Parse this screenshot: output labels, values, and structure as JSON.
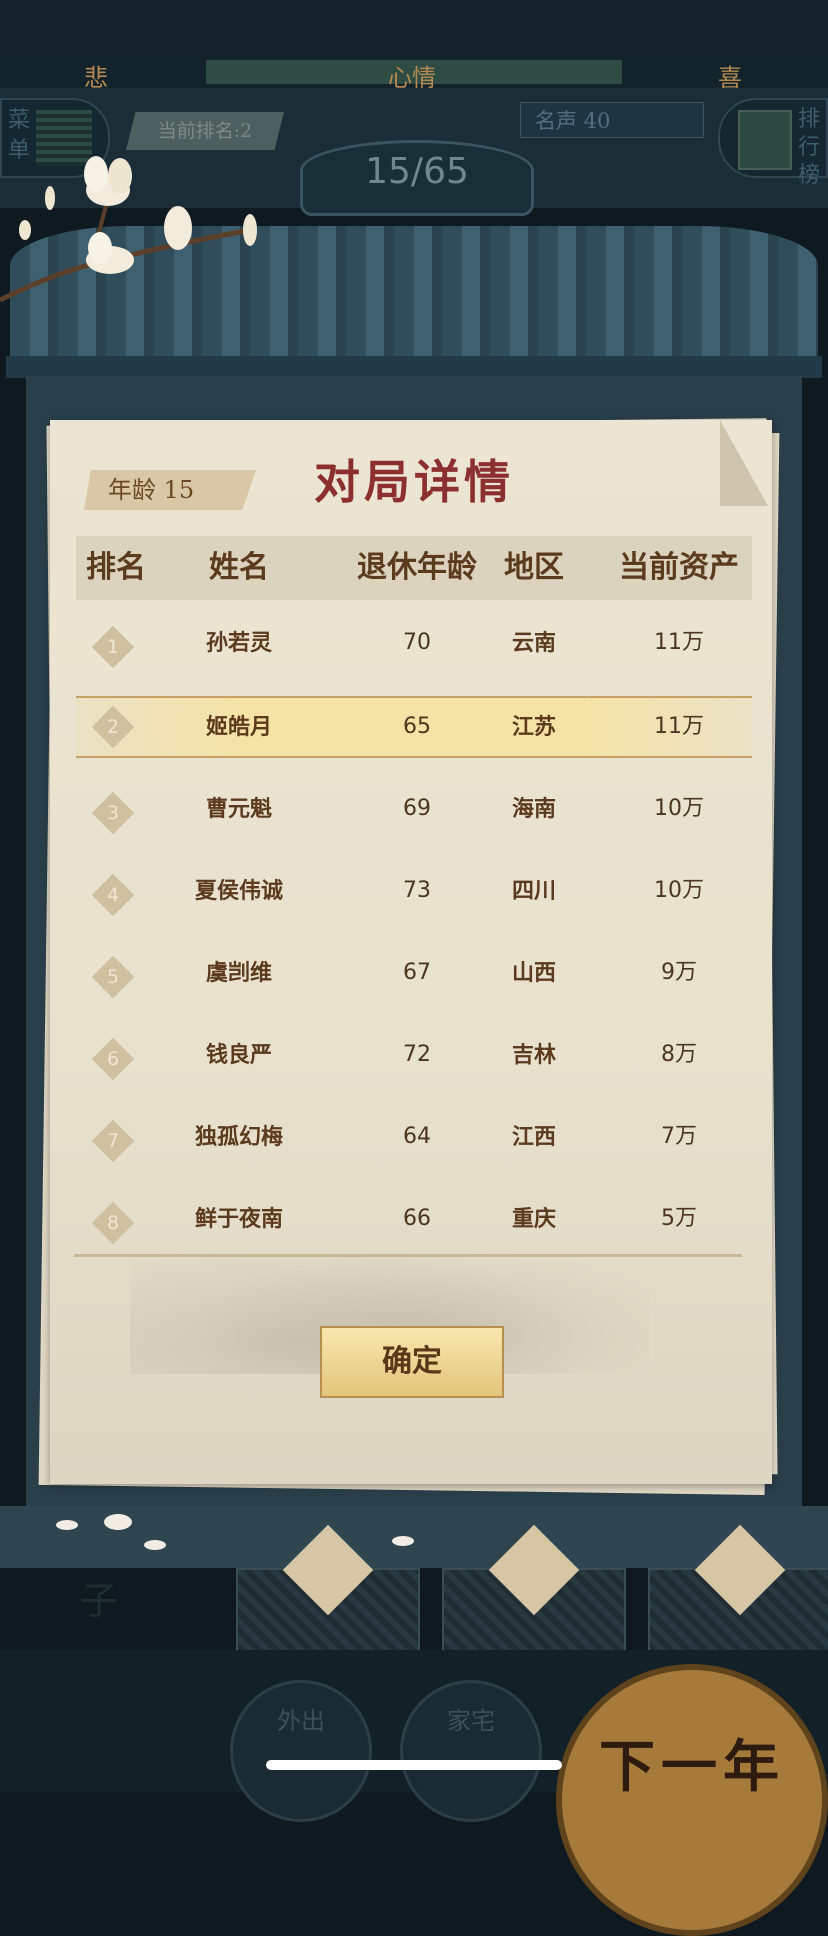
{
  "mood": {
    "left": "悲",
    "center": "心情",
    "right": "喜"
  },
  "hud": {
    "menu_label": "菜单",
    "current_rank": "当前排名:2",
    "fame": "名声 40",
    "turn": "15/65",
    "leaderboard_label": "排行榜"
  },
  "dialog": {
    "age_tag": "年龄 15",
    "title": "对局详情",
    "headers": [
      "排名",
      "姓名",
      "退休年龄",
      "地区",
      "当前资产"
    ],
    "rows": [
      {
        "rank": "1",
        "name": "孙若灵",
        "age": "70",
        "region": "云南",
        "assets": "11万"
      },
      {
        "rank": "2",
        "name": "姬皓月",
        "age": "65",
        "region": "江苏",
        "assets": "11万"
      },
      {
        "rank": "3",
        "name": "曹元魁",
        "age": "69",
        "region": "海南",
        "assets": "10万"
      },
      {
        "rank": "4",
        "name": "夏侯伟诚",
        "age": "73",
        "region": "四川",
        "assets": "10万"
      },
      {
        "rank": "5",
        "name": "虞剀维",
        "age": "67",
        "region": "山西",
        "assets": "9万"
      },
      {
        "rank": "6",
        "name": "钱良严",
        "age": "72",
        "region": "吉林",
        "assets": "8万"
      },
      {
        "rank": "7",
        "name": "独孤幻梅",
        "age": "64",
        "region": "江西",
        "assets": "7万"
      },
      {
        "rank": "8",
        "name": "鲜于夜南",
        "age": "66",
        "region": "重庆",
        "assets": "5万"
      }
    ],
    "confirm": "确定"
  },
  "bottom": {
    "side_char": "子",
    "go_out": "外出",
    "home": "家宅",
    "next_year": "下一年"
  },
  "colors": {
    "title": "#8c2f2f",
    "highlight": "#f5e3a6",
    "paper": "#ece5d3"
  }
}
